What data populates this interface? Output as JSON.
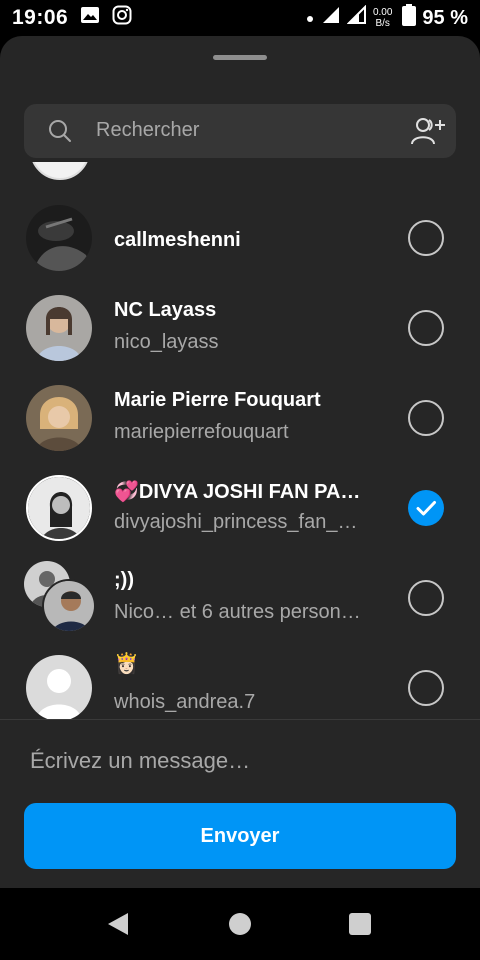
{
  "status_bar": {
    "time": "19:06",
    "net_speed_value": "0.00",
    "net_speed_unit": "B/s",
    "battery": "95 %",
    "icons": [
      "gallery-icon",
      "instagram-icon",
      "dot-icon",
      "signal-icon",
      "signal-icon",
      "battery-icon"
    ]
  },
  "search": {
    "placeholder": "Rechercher"
  },
  "contacts": [
    {
      "name": "callmeshenni",
      "subtitle": "",
      "selected": false,
      "avatar": "avatar-photo-bw"
    },
    {
      "name": "NC Layass",
      "subtitle": "nico_layass",
      "selected": false,
      "avatar": "avatar-photo"
    },
    {
      "name": "Marie Pierre Fouquart",
      "subtitle": "mariepierrefouquart",
      "selected": false,
      "avatar": "avatar-photo"
    },
    {
      "name": "💞DIVYA JOSHI FAN PA…",
      "subtitle": "divyajoshi_princess_fan_…",
      "selected": true,
      "avatar": "avatar-photo"
    },
    {
      "name": ";))",
      "subtitle": "Nico… et 6 autres person…",
      "selected": false,
      "avatar": "group-avatar"
    },
    {
      "name": "👸🏻",
      "subtitle": "whois_andrea.7",
      "selected": false,
      "avatar": "default-avatar"
    }
  ],
  "message": {
    "placeholder": "Écrivez un message…"
  },
  "send_label": "Envoyer",
  "colors": {
    "accent": "#0095f6",
    "sheet_bg": "#262626",
    "secondary_text": "#a8a8a8"
  }
}
